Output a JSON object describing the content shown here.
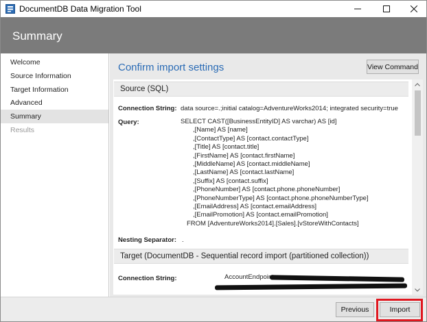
{
  "window": {
    "title": "DocumentDB Data Migration Tool"
  },
  "header": {
    "title": "Summary"
  },
  "nav": {
    "items": [
      {
        "label": "Welcome",
        "state": "normal"
      },
      {
        "label": "Source Information",
        "state": "normal"
      },
      {
        "label": "Target Information",
        "state": "normal"
      },
      {
        "label": "Advanced",
        "state": "normal"
      },
      {
        "label": "Summary",
        "state": "active"
      },
      {
        "label": "Results",
        "state": "disabled"
      }
    ]
  },
  "main": {
    "title": "Confirm import settings",
    "view_command_label": "View Command",
    "source": {
      "heading": "Source (SQL)",
      "connection_label": "Connection String:",
      "connection_value": "data source=.;initial catalog=AdventureWorks2014; integrated security=true",
      "query_label": "Query:",
      "query_lines": [
        "SELECT CAST([BusinessEntityID] AS varchar) AS [id]",
        ",[Name] AS [name]",
        ",[ContactType] AS [contact.contactType]",
        ",[Title] AS [contact.title]",
        ",[FirstName] AS [contact.firstName]",
        ",[MiddleName] AS [contact.middleName]",
        ",[LastName] AS [contact.lastName]",
        ",[Suffix] AS [contact.suffix]",
        ",[PhoneNumber] AS [contact.phone.phoneNumber]",
        ",[PhoneNumberType] AS [contact.phone.phoneNumberType]",
        ",[EmailAddress] AS [contact.emailAddress]",
        ",[EmailPromotion] AS [contact.emailPromotion]",
        "FROM [AdventureWorks2014].[Sales].[vStoreWithContacts]"
      ],
      "nesting_label": "Nesting Separator:",
      "nesting_value": "."
    },
    "target": {
      "heading": "Target (DocumentDB - Sequential record import (partitioned collection))",
      "connection_label": "Connection String:",
      "connection_value_prefix": "AccountEndpoint="
    }
  },
  "footer": {
    "previous_label": "Previous",
    "import_label": "Import"
  },
  "colors": {
    "header_bg": "#7b7b7b",
    "accent_title": "#2a6bb5",
    "highlight": "#e0161f"
  }
}
